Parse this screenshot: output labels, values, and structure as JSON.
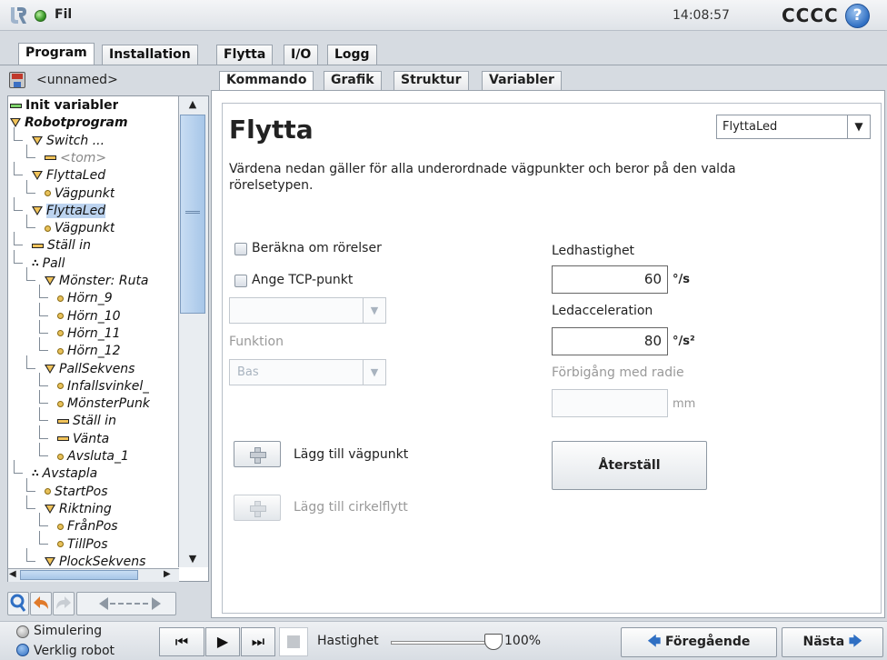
{
  "topbar": {
    "file_label": "Fil",
    "clock": "14:08:57",
    "robot_name": "CCCC",
    "help_glyph": "?"
  },
  "main_tabs": [
    {
      "label": "Program",
      "active": true
    },
    {
      "label": "Installation",
      "active": false
    },
    {
      "label": "Flytta",
      "active": false
    },
    {
      "label": "I/O",
      "active": false
    },
    {
      "label": "Logg",
      "active": false
    }
  ],
  "left": {
    "filename": "<unnamed>",
    "tree": [
      {
        "label": "Init variabler",
        "icon": "bar-green",
        "bold": true
      },
      {
        "label": "Robotprogram",
        "icon": "triangle",
        "bold": true,
        "italic": true
      },
      {
        "label": "Switch ...",
        "icon": "triangle",
        "italic": true
      },
      {
        "label": "<tom>",
        "icon": "bar",
        "italic": true,
        "gray": true
      },
      {
        "label": "FlyttaLed",
        "icon": "triangle",
        "italic": true
      },
      {
        "label": "Vägpunkt",
        "icon": "waypoint",
        "italic": true
      },
      {
        "label": "FlyttaLed",
        "icon": "triangle",
        "italic": true,
        "selected": true
      },
      {
        "label": "Vägpunkt",
        "icon": "waypoint",
        "italic": true
      },
      {
        "label": "Ställ in",
        "icon": "bar",
        "italic": true
      },
      {
        "label": "Pall",
        "icon": "pallet",
        "italic": true
      },
      {
        "label": "Mönster: Ruta",
        "icon": "triangle",
        "italic": true
      },
      {
        "label": "Hörn_9",
        "icon": "waypoint",
        "italic": true
      },
      {
        "label": "Hörn_10",
        "icon": "waypoint",
        "italic": true
      },
      {
        "label": "Hörn_11",
        "icon": "waypoint",
        "italic": true
      },
      {
        "label": "Hörn_12",
        "icon": "waypoint",
        "italic": true
      },
      {
        "label": "PallSekvens",
        "icon": "triangle",
        "italic": true
      },
      {
        "label": "Infallsvinkel_",
        "icon": "waypoint",
        "italic": true
      },
      {
        "label": "MönsterPunk",
        "icon": "waypoint",
        "italic": true
      },
      {
        "label": "Ställ in",
        "icon": "bar",
        "italic": true
      },
      {
        "label": "Vänta",
        "icon": "bar",
        "italic": true
      },
      {
        "label": "Avsluta_1",
        "icon": "waypoint",
        "italic": true
      },
      {
        "label": "Avstapla",
        "icon": "pallet",
        "italic": true
      },
      {
        "label": "StartPos",
        "icon": "waypoint",
        "italic": true
      },
      {
        "label": "Riktning",
        "icon": "triangle",
        "italic": true
      },
      {
        "label": "FrånPos",
        "icon": "waypoint",
        "italic": true
      },
      {
        "label": "TillPos",
        "icon": "waypoint",
        "italic": true
      },
      {
        "label": "PlockSekvens",
        "icon": "triangle",
        "italic": true
      }
    ]
  },
  "content_tabs": [
    {
      "label": "Kommando",
      "active": true
    },
    {
      "label": "Grafik",
      "active": false
    },
    {
      "label": "Struktur",
      "active": false
    },
    {
      "label": "Variabler",
      "active": false
    }
  ],
  "move": {
    "title": "Flytta",
    "type_selected": "FlyttaLed",
    "description": "Värdena nedan gäller för alla underordnade vägpunkter och beror på den valda rörelsetypen.",
    "recalc_label": "Beräkna om rörelser",
    "tcp_label": "Ange TCP-punkt",
    "tcp_value": "",
    "feature_label": "Funktion",
    "feature_value": "Bas",
    "joint_speed_label": "Ledhastighet",
    "joint_speed_value": "60",
    "joint_speed_unit": "°/s",
    "joint_accel_label": "Ledacceleration",
    "joint_accel_value": "80",
    "joint_accel_unit": "°/s²",
    "blend_label": "Förbigång med radie",
    "blend_value": "",
    "blend_unit": "mm",
    "add_waypoint": "Lägg till vägpunkt",
    "add_circle": "Lägg till cirkelflytt",
    "reset": "Återställ"
  },
  "bottom": {
    "sim_label": "Simulering",
    "real_label": "Verklig robot",
    "speed_label": "Hastighet",
    "speed_value": "100%",
    "speed_fraction": 1.0,
    "prev": "Föregående",
    "next": "Nästa"
  },
  "colors": {
    "accent": "#2f6fc3",
    "selection": "#bcd3ef",
    "status_green": "#3c9b2a"
  }
}
